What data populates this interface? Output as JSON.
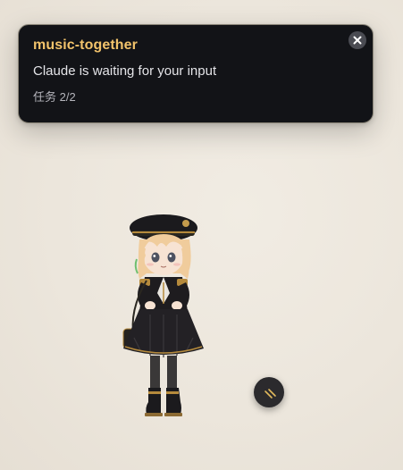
{
  "notification": {
    "title": "music-together",
    "message": "Claude is waiting for your input",
    "task_progress": "任务 2/2",
    "close_icon": "close-icon"
  },
  "floating_button": {
    "icon": "resize-grip-icon"
  },
  "mascot": {
    "icon": "chibi-character-image"
  },
  "colors": {
    "toast_background": "#121317",
    "title_accent": "#f2c36b",
    "page_background": "#ece6dc"
  }
}
